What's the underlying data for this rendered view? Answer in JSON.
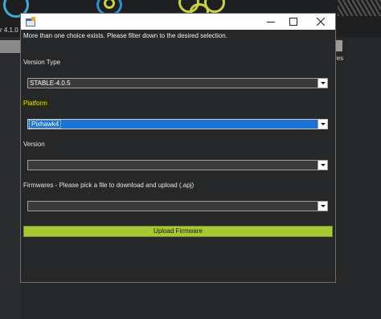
{
  "background_app": {
    "version_fragment": "r 4.1.0",
    "right_fragment": "res"
  },
  "dialog": {
    "title": "",
    "controls": {
      "minimize": "minimize",
      "maximize": "maximize",
      "close": "close"
    },
    "message": "More than one choice exists. Please filter down to the desired selection.",
    "version_type": {
      "label": "Version Type",
      "value": "STABLE-4.0.5"
    },
    "platform": {
      "label": "Platform",
      "value": "Pixhawk4"
    },
    "version": {
      "label": "Version",
      "value": ""
    },
    "firmwares": {
      "label": "Firmwares - Please pick a file to download and upload (.apj)",
      "value": ""
    },
    "upload_button": "Upload Firmware"
  },
  "colors": {
    "dialog_bg": "#262729",
    "selection_blue": "#1b74d4",
    "upload_green": "#a8c934",
    "platform_label_highlight": "#e6e400"
  },
  "icons": [
    "app-icon",
    "minimize-icon",
    "maximize-icon",
    "close-icon",
    "dropdown-arrow-icon"
  ]
}
